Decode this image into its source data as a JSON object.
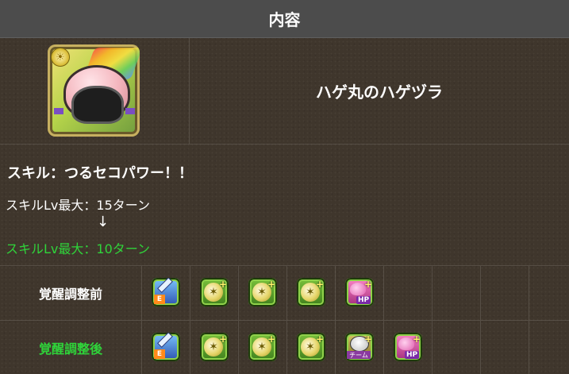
{
  "header": {
    "title": "内容"
  },
  "skill": {
    "name": "ハゲ丸のハゲヅラ",
    "title": "スキル：つるセコパワー！！",
    "lv_before": "スキルLv最大：15ターン",
    "arrow": "↓",
    "lv_after": "スキルLv最大：10ターン"
  },
  "awakenings": {
    "before_label": "覚醒調整前",
    "after_label": "覚醒調整後",
    "before": [
      "extend-time-icon",
      "bind-resist-plus-icon",
      "bind-resist-plus-icon",
      "bind-resist-plus-icon",
      "hp-plus-icon"
    ],
    "after": [
      "extend-time-icon",
      "bind-resist-plus-icon",
      "bind-resist-plus-icon",
      "bind-resist-plus-icon",
      "team-bind-resist-icon",
      "hp-plus-icon"
    ],
    "labels": {
      "extend_tag": "E",
      "hp_tag": "HP",
      "team_tag": "チーム"
    }
  },
  "colors": {
    "accent_green": "#2fd33a",
    "header_bg": "#4c4c4c",
    "page_bg": "#3f362c"
  }
}
